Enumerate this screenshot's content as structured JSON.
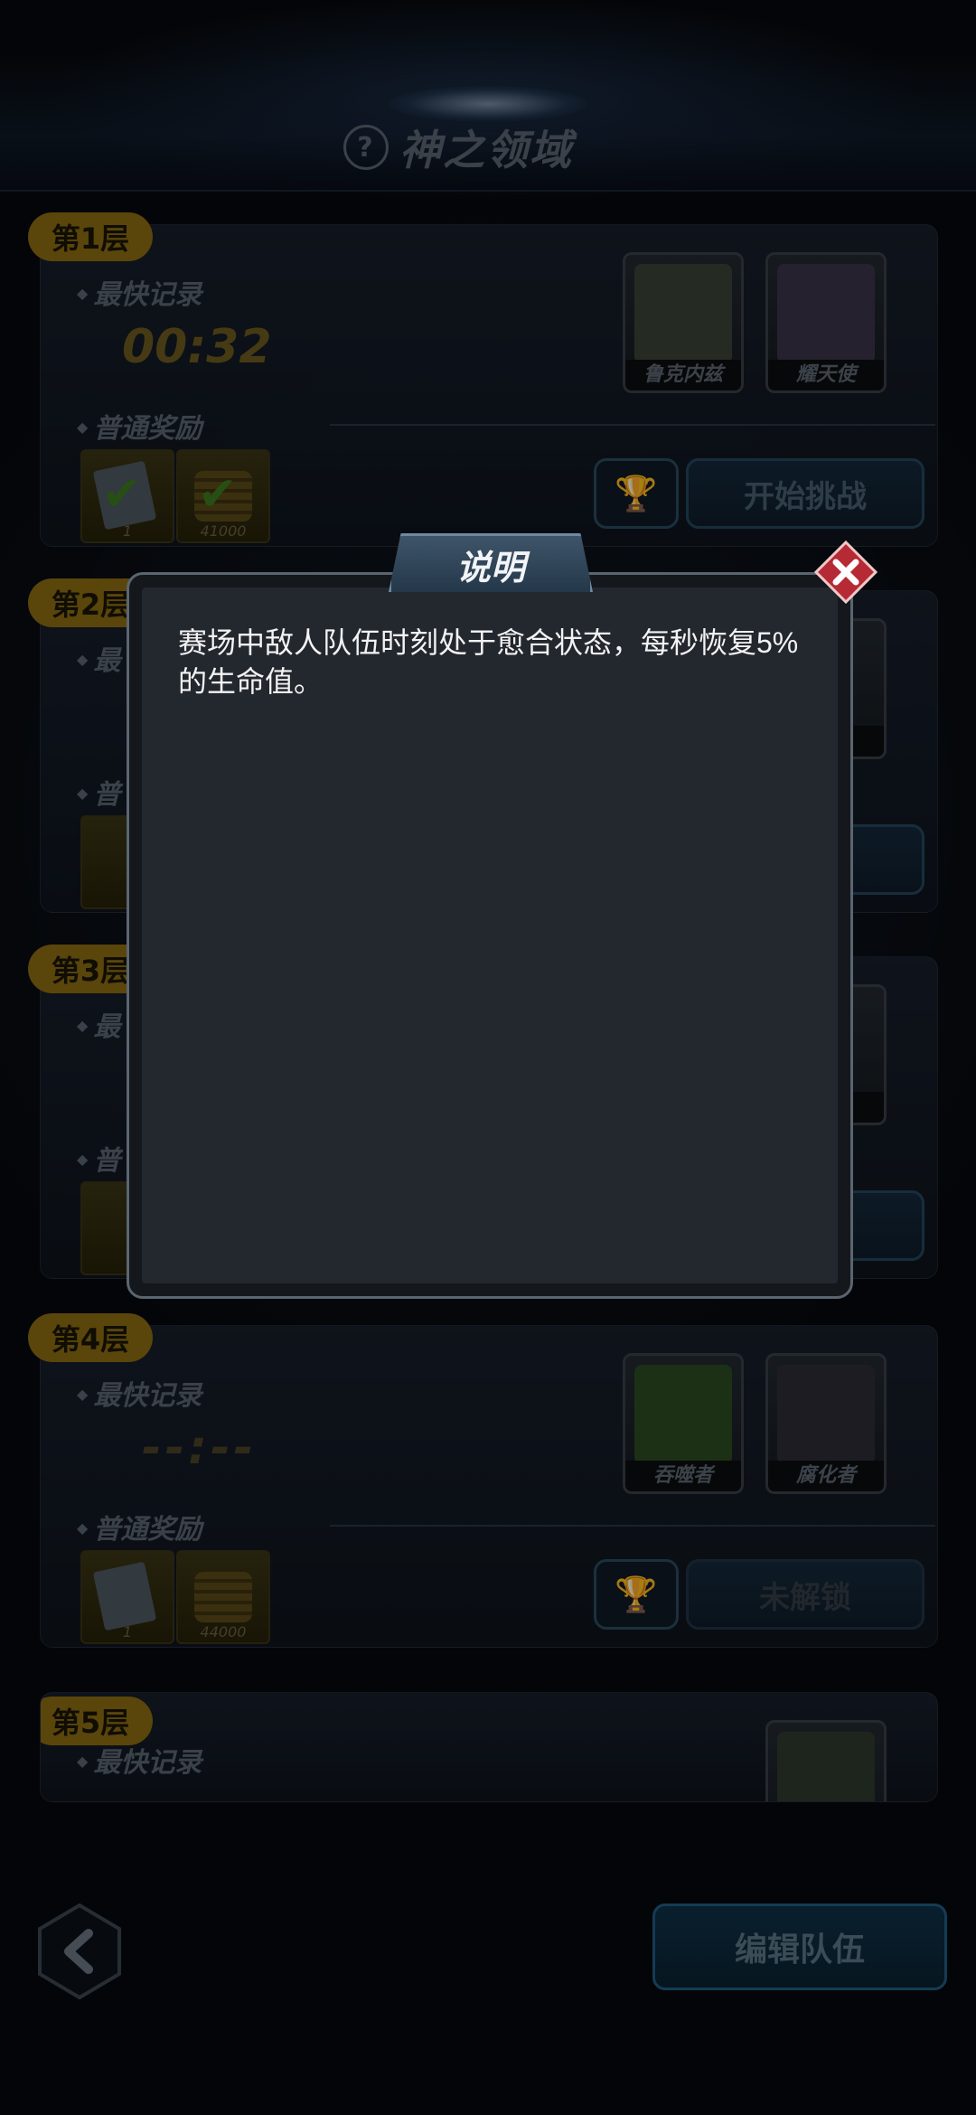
{
  "header": {
    "title": "神之领域",
    "help_icon": "question-circle-icon"
  },
  "tiers": [
    {
      "badge": "第1层",
      "record_label": "最快记录",
      "record_time": "00:32",
      "reward_label": "普通奖励",
      "rewards": [
        {
          "qty": "1",
          "claimed": true
        },
        {
          "qty": "41000",
          "claimed": true
        }
      ],
      "action_label": "开始挑战",
      "enemies": [
        "鲁克内兹",
        "耀天使"
      ]
    },
    {
      "badge": "第2层",
      "record_label": "最",
      "reward_label": "普",
      "action_label": "战",
      "enemies": [
        "曾"
      ]
    },
    {
      "badge": "第3层",
      "record_label": "最",
      "reward_label": "普",
      "enemies": [
        "驭者"
      ]
    },
    {
      "badge": "第4层",
      "record_label": "最快记录",
      "record_time": "--:--",
      "reward_label": "普通奖励",
      "rewards": [
        {
          "qty": "1",
          "claimed": false
        },
        {
          "qty": "44000",
          "claimed": false
        }
      ],
      "action_label": "未解锁",
      "enemies": [
        "吞噬者",
        "腐化者"
      ]
    },
    {
      "badge": "第5层",
      "record_label": "最快记录"
    }
  ],
  "bottom": {
    "edit_team_label": "编辑队伍",
    "back_icon": "chevron-left-icon"
  },
  "dialog": {
    "title": "说明",
    "body": "赛场中敌人队伍时刻处于愈合状态，每秒恢复5%的生命值。",
    "close_icon": "close-icon"
  },
  "colors": {
    "badge": "#8a6a12",
    "accent_blue": "#1f5d80",
    "close_red": "#c0313c"
  }
}
